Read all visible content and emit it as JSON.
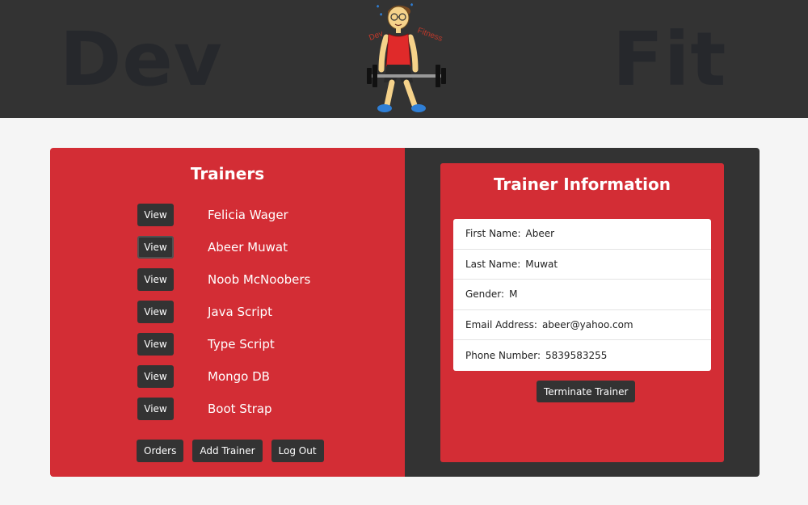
{
  "header": {
    "brand_left": "Dev",
    "brand_right": "Fit",
    "logo_text_left": "Dev",
    "logo_text_right": "Fitness"
  },
  "trainers": {
    "title": "Trainers",
    "view_label": "View",
    "items": [
      {
        "name": "Felicia Wager"
      },
      {
        "name": "Abeer Muwat"
      },
      {
        "name": "Noob McNoobers"
      },
      {
        "name": "Java Script"
      },
      {
        "name": "Type Script"
      },
      {
        "name": "Mongo DB"
      },
      {
        "name": "Boot Strap"
      }
    ],
    "actions": {
      "orders": "Orders",
      "add_trainer": "Add Trainer",
      "log_out": "Log Out"
    }
  },
  "info": {
    "title": "Trainer Information",
    "first_name_label": "First Name:",
    "first_name": "Abeer",
    "last_name_label": "Last Name:",
    "last_name": "Muwat",
    "gender_label": "Gender:",
    "gender": "M",
    "email_label": "Email Address:",
    "email": "abeer@yahoo.com",
    "phone_label": "Phone Number:",
    "phone": "5839583255",
    "terminate_label": "Terminate Trainer"
  },
  "colors": {
    "header_bg": "#333333",
    "accent_red": "#d32d35",
    "dark": "#333333",
    "page_bg": "#f5f5f5"
  }
}
